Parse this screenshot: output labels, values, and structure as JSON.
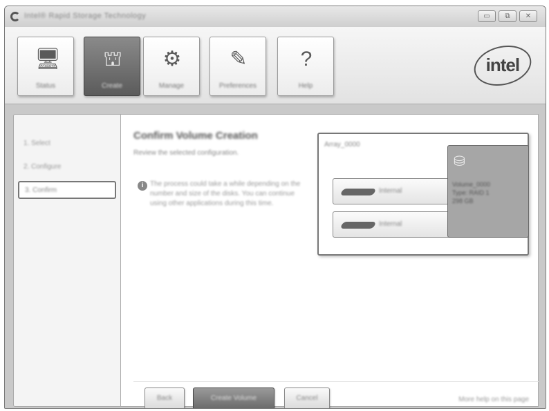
{
  "window": {
    "title": "Intel® Rapid Storage Technology",
    "controls": {
      "minimize": "▭",
      "maximize": "⧉",
      "close": "✕"
    }
  },
  "toolbar": {
    "items": [
      {
        "label": "Status",
        "icon": "monitor-icon",
        "glyph": "🖥"
      },
      {
        "label": "Create",
        "icon": "create-volume-icon",
        "glyph": "⛫"
      },
      {
        "label": "Manage",
        "icon": "gear-icon",
        "glyph": "⚙"
      },
      {
        "label": "Preferences",
        "icon": "preferences-icon",
        "glyph": "✎"
      },
      {
        "label": "Help",
        "icon": "help-icon",
        "glyph": "?"
      }
    ],
    "logo": "intel"
  },
  "sidebar": {
    "steps": [
      {
        "label": "1. Select"
      },
      {
        "label": "2. Configure"
      },
      {
        "label": "3. Confirm"
      }
    ]
  },
  "content": {
    "heading": "Confirm Volume Creation",
    "subheading": "Review the selected configuration.",
    "info_icon": "i",
    "info_text": "The process could take a while depending on the number and size of the disks. You can continue using other applications during this time.",
    "array_label": "Array_0000",
    "disks": [
      {
        "name": "Internal"
      },
      {
        "name": "Internal"
      }
    ],
    "volume": {
      "icon_glyph": "⛁",
      "info_lines": [
        "Volume_0000",
        "Type: RAID 1",
        "298 GB"
      ]
    }
  },
  "footer": {
    "back_label": "Back",
    "create_label": "Create Volume",
    "cancel_label": "Cancel",
    "more_help": "More help on this page"
  }
}
